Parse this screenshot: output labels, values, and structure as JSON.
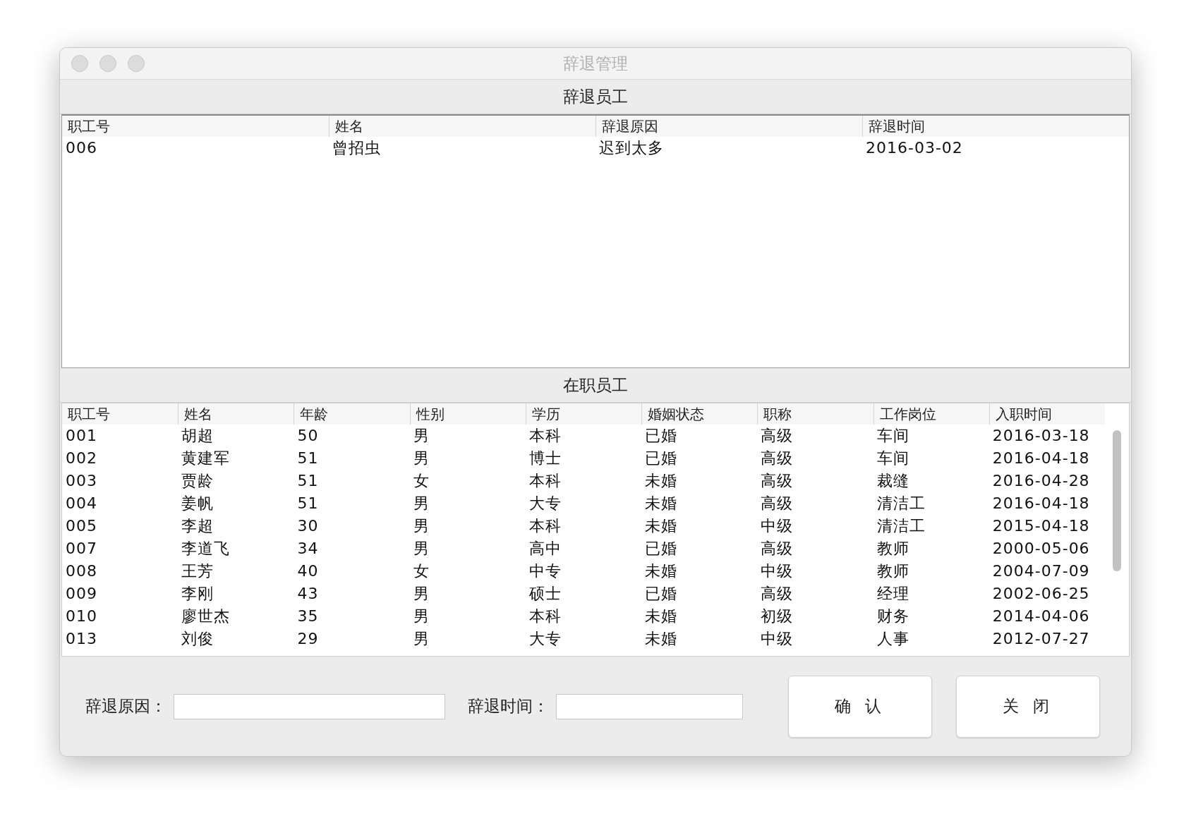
{
  "window": {
    "title": "辞退管理"
  },
  "dismissed": {
    "title": "辞退员工",
    "columns": [
      "职工号",
      "姓名",
      "辞退原因",
      "辞退时间"
    ],
    "rows": [
      [
        "006",
        "曾招虫",
        "迟到太多",
        "2016-03-02"
      ]
    ]
  },
  "employees": {
    "title": "在职员工",
    "columns": [
      "职工号",
      "姓名",
      "年龄",
      "性别",
      "学历",
      "婚姻状态",
      "职称",
      "工作岗位",
      "入职时间"
    ],
    "rows": [
      [
        "001",
        "胡超",
        "50",
        "男",
        "本科",
        "已婚",
        "高级",
        "车间",
        "2016-03-18"
      ],
      [
        "002",
        "黄建军",
        "51",
        "男",
        "博士",
        "已婚",
        "高级",
        "车间",
        "2016-04-18"
      ],
      [
        "003",
        "贾龄",
        "51",
        "女",
        "本科",
        "未婚",
        "高级",
        "裁缝",
        "2016-04-28"
      ],
      [
        "004",
        "姜帆",
        "51",
        "男",
        "大专",
        "未婚",
        "高级",
        "清洁工",
        "2016-04-18"
      ],
      [
        "005",
        "李超",
        "30",
        "男",
        "本科",
        "未婚",
        "中级",
        "清洁工",
        "2015-04-18"
      ],
      [
        "007",
        "李道飞",
        "34",
        "男",
        "高中",
        "已婚",
        "高级",
        "教师",
        "2000-05-06"
      ],
      [
        "008",
        "王芳",
        "40",
        "女",
        "中专",
        "未婚",
        "中级",
        "教师",
        "2004-07-09"
      ],
      [
        "009",
        "李刚",
        "43",
        "男",
        "硕士",
        "已婚",
        "高级",
        "经理",
        "2002-06-25"
      ],
      [
        "010",
        "廖世杰",
        "35",
        "男",
        "本科",
        "未婚",
        "初级",
        "财务",
        "2014-04-06"
      ],
      [
        "013",
        "刘俊",
        "29",
        "男",
        "大专",
        "未婚",
        "中级",
        "人事",
        "2012-07-27"
      ]
    ]
  },
  "form": {
    "fields": [
      {
        "label": "辞退原因："
      },
      {
        "label": "辞退时间："
      }
    ],
    "buttons": [
      "确 认",
      "关 闭"
    ]
  }
}
